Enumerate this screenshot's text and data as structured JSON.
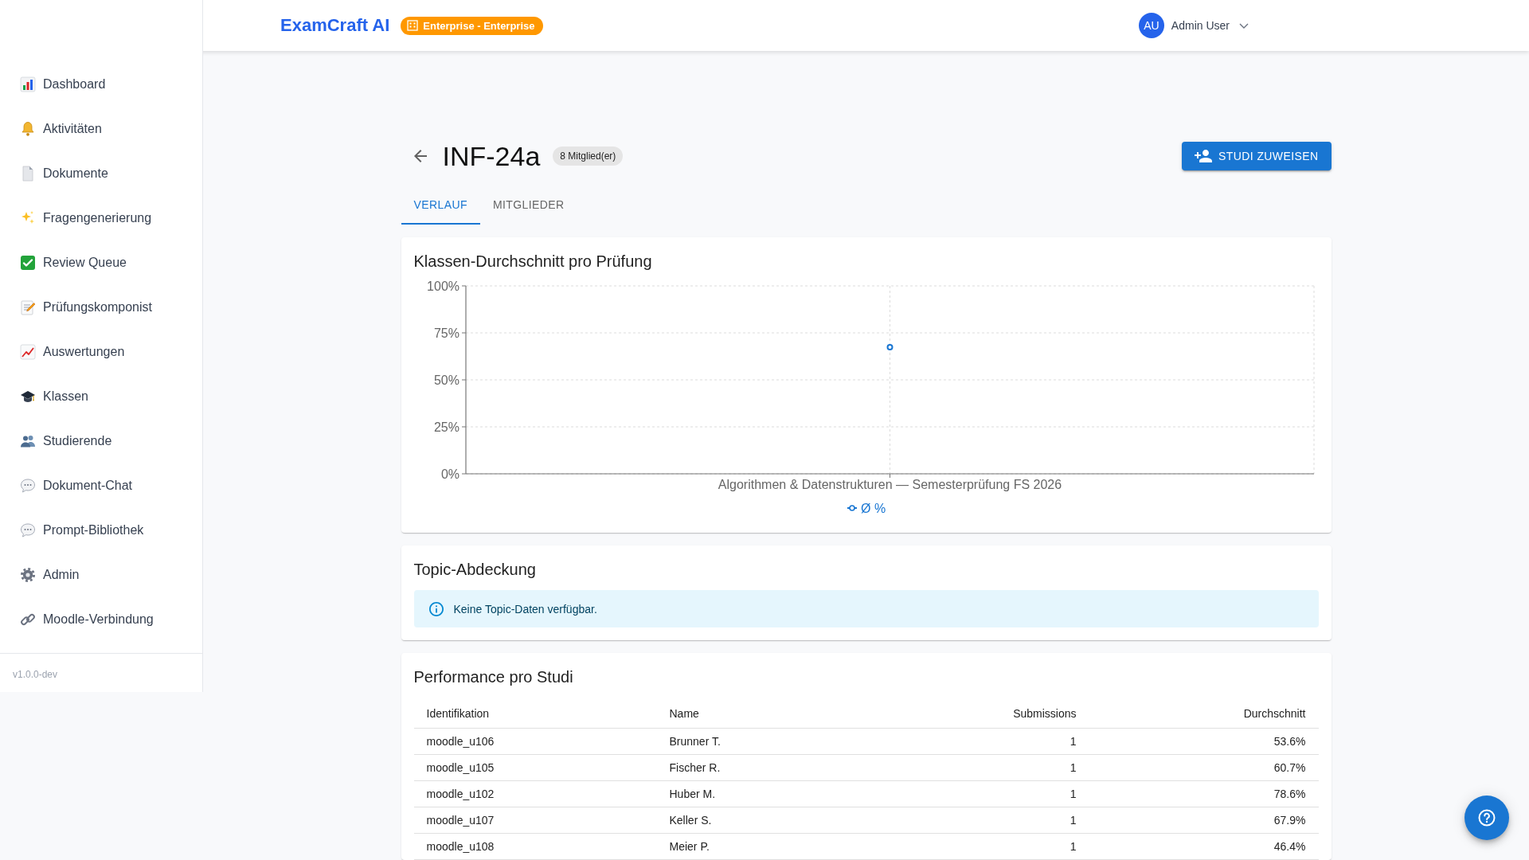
{
  "header": {
    "logo": "ExamCraft AI",
    "plan_badge": "Enterprise - Enterprise",
    "user": {
      "initials": "AU",
      "name": "Admin User"
    }
  },
  "sidebar": {
    "items": [
      "Dashboard",
      "Aktivitäten",
      "Dokumente",
      "Fragengenerierung",
      "Review Queue",
      "Prüfungskomponist",
      "Auswertungen",
      "Klassen",
      "Studierende",
      "Dokument-Chat",
      "Prompt-Bibliothek",
      "Admin",
      "Moodle-Verbindung"
    ],
    "version": "v1.0.0-dev"
  },
  "page_header": {
    "title": "INF-24a",
    "member_count": "8 Mitglied(er)",
    "assign_button": "STUDI ZUWEISEN"
  },
  "tabs": [
    {
      "label": "VERLAUF",
      "selected": true
    },
    {
      "label": "MITGLIEDER",
      "selected": false
    }
  ],
  "average_card": {
    "chart_data": {
      "type": "line",
      "title": "Klassen-Durchschnitt pro Prüfung",
      "categories": [
        "Algorithmen & Datenstrukturen — Semesterprüfung FS 2026"
      ],
      "series": [
        {
          "name": "Ø %",
          "color": "#1976d2",
          "marker": "circle",
          "values": [
            67.4
          ]
        }
      ],
      "ylim": [
        0,
        100
      ],
      "yticks": [
        {
          "value": 0,
          "label": "0%"
        },
        {
          "value": 25,
          "label": "25%"
        },
        {
          "value": 50,
          "label": "50%"
        },
        {
          "value": 75,
          "label": "75%"
        },
        {
          "value": 100,
          "label": "100%"
        }
      ],
      "grid": true
    }
  },
  "topic_card": {
    "title": "Topic-Abdeckung",
    "info_message": "Keine Topic-Daten verfügbar."
  },
  "performance_card": {
    "title": "Performance pro Studi",
    "columns": [
      {
        "label": "Identifikation",
        "kind": "text"
      },
      {
        "label": "Name",
        "kind": "text"
      },
      {
        "label": "Submissions",
        "kind": "number"
      },
      {
        "label": "Durchschnitt",
        "kind": "number"
      }
    ],
    "rows": [
      [
        "moodle_u106",
        "Brunner T.",
        "1",
        "53.6%"
      ],
      [
        "moodle_u105",
        "Fischer R.",
        "1",
        "60.7%"
      ],
      [
        "moodle_u102",
        "Huber M.",
        "1",
        "78.6%"
      ],
      [
        "moodle_u107",
        "Keller S.",
        "1",
        "67.9%"
      ],
      [
        "moodle_u108",
        "Meier P.",
        "1",
        "46.4%"
      ]
    ]
  }
}
